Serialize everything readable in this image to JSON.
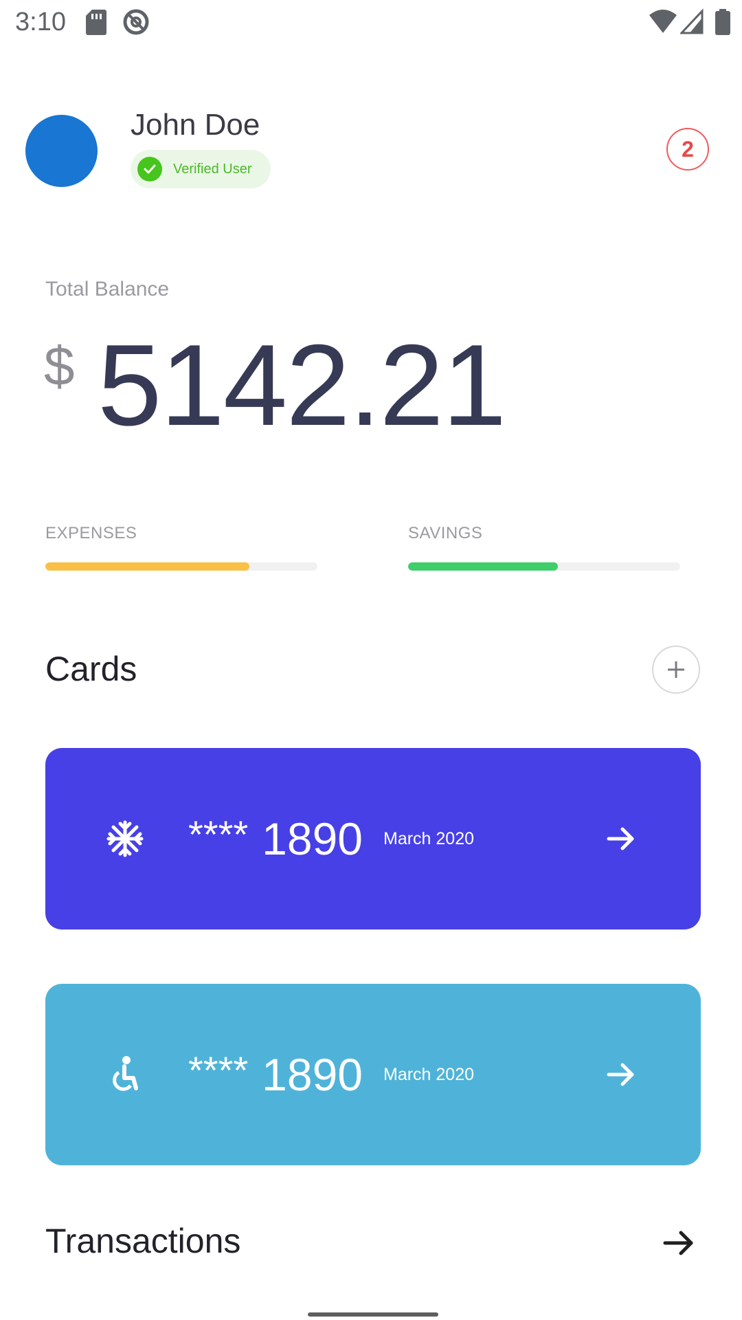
{
  "status_bar": {
    "time": "3:10",
    "icons": [
      "sd-card-icon",
      "at-sign-icon",
      "wifi-icon",
      "cellular-signal-icon",
      "battery-icon"
    ]
  },
  "profile": {
    "name": "John Doe",
    "verified_label": "Verified User",
    "notification_count": "2",
    "avatar_color": "#1976d2"
  },
  "balance": {
    "label": "Total Balance",
    "currency": "$",
    "amount": "5142.21"
  },
  "progress": [
    {
      "label": "EXPENSES",
      "fraction": 0.75,
      "color": "#f8c047"
    },
    {
      "label": "SAVINGS",
      "fraction": 0.55,
      "color": "#3fce6a"
    }
  ],
  "cards_section": {
    "title": "Cards",
    "add_icon": "plus-icon",
    "cards": [
      {
        "icon": "snowflake-icon",
        "mask": "****",
        "number": "1890",
        "date": "March 2020",
        "color": "#4740e6"
      },
      {
        "icon": "wheelchair-icon",
        "mask": "****",
        "number": "1890",
        "date": "March 2020",
        "color": "#4fb3d9"
      }
    ]
  },
  "transactions_section": {
    "title": "Transactions",
    "arrow_icon": "arrow-right-icon"
  }
}
